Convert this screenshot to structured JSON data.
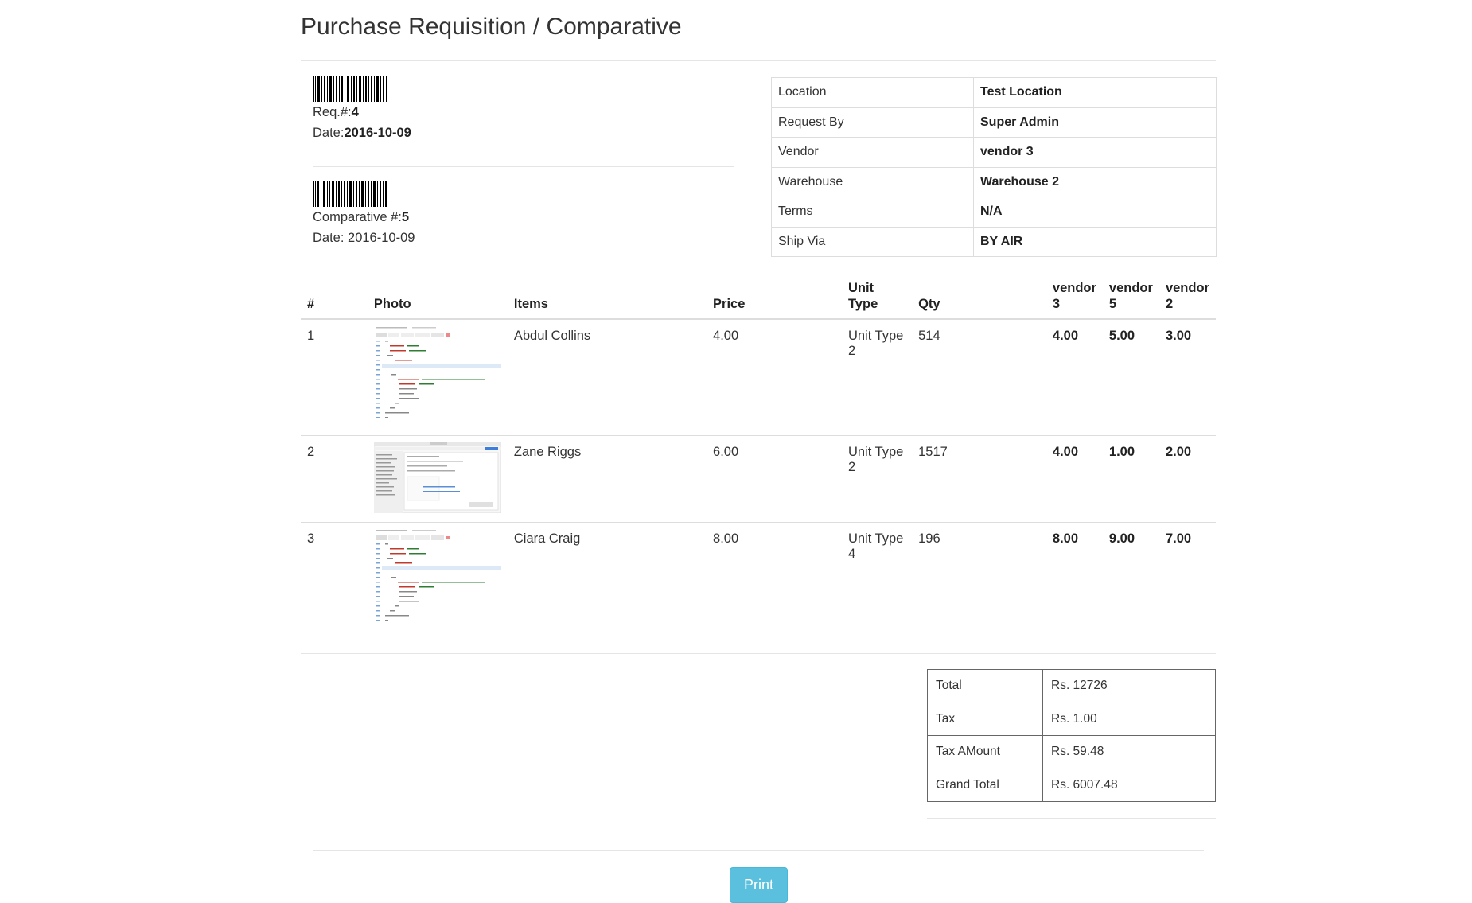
{
  "page_title": "Purchase Requisition / Comparative",
  "requisition": {
    "req_label": "Req.#:",
    "req_value": "4",
    "date_label": "Date:",
    "date_value": "2016-10-09"
  },
  "comparative": {
    "comp_label": "Comparative #:",
    "comp_value": "5",
    "date_label": "Date: ",
    "date_value": "2016-10-09"
  },
  "info_rows": [
    {
      "label": "Location",
      "value": "Test Location"
    },
    {
      "label": "Request By",
      "value": "Super Admin"
    },
    {
      "label": "Vendor",
      "value": "vendor 3"
    },
    {
      "label": "Warehouse",
      "value": "Warehouse 2"
    },
    {
      "label": "Terms",
      "value": "N/A"
    },
    {
      "label": "Ship Via",
      "value": "BY AIR"
    }
  ],
  "items_table": {
    "headers": [
      "#",
      "Photo",
      "Items",
      "Price",
      "Unit Type",
      "Qty",
      "vendor 3",
      "vendor 5",
      "vendor 2"
    ],
    "rows": [
      {
        "num": "1",
        "item": "Abdul Collins",
        "price": "4.00",
        "unit_type": "Unit Type 2",
        "qty": "514",
        "v3": "4.00",
        "v5": "5.00",
        "v2": "3.00"
      },
      {
        "num": "2",
        "item": "Zane Riggs",
        "price": "6.00",
        "unit_type": "Unit Type 2",
        "qty": "1517",
        "v3": "4.00",
        "v5": "1.00",
        "v2": "2.00"
      },
      {
        "num": "3",
        "item": "Ciara Craig",
        "price": "8.00",
        "unit_type": "Unit Type 4",
        "qty": "196",
        "v3": "8.00",
        "v5": "9.00",
        "v2": "7.00"
      }
    ]
  },
  "totals": [
    {
      "label": "Total",
      "value": "Rs. 12726"
    },
    {
      "label": "Tax",
      "value": "Rs. 1.00"
    },
    {
      "label": "Tax AMount",
      "value": "Rs. 59.48"
    },
    {
      "label": "Grand Total",
      "value": "Rs. 6007.48"
    }
  ],
  "print_label": "Print"
}
